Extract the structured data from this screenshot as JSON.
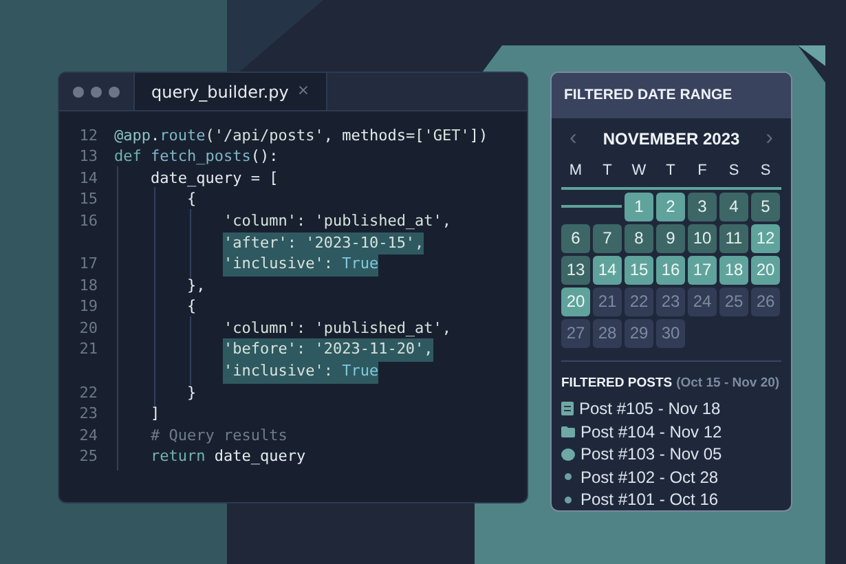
{
  "editor": {
    "tab": {
      "label": "query_builder.py",
      "close": "×",
      "selected": true
    },
    "lines": [
      {
        "number": "12",
        "tokens": [
          {
            "text": "@app",
            "kind": "deco"
          },
          {
            "text": ".",
            "kind": "plain"
          },
          {
            "text": "route",
            "kind": "func"
          },
          {
            "text": "('/api/posts'",
            "kind": "string"
          },
          {
            "text": ", methods=[",
            "kind": "plain"
          },
          {
            "text": "'GET'",
            "kind": "string"
          },
          {
            "text": "])",
            "kind": "plain"
          }
        ]
      },
      {
        "number": "13",
        "tokens": [
          {
            "text": "def ",
            "kind": "keyword"
          },
          {
            "text": "fetch_posts",
            "kind": "func"
          },
          {
            "text": "():",
            "kind": "plain"
          }
        ]
      },
      {
        "number": "14",
        "tokens": [
          {
            "text": "    date_query = [",
            "kind": "plain"
          }
        ]
      },
      {
        "number": "15",
        "tokens": [
          {
            "text": "        {",
            "kind": "plain"
          }
        ]
      },
      {
        "number": "16",
        "tokens": [
          {
            "text": "            'column': 'published_at',",
            "kind": "string"
          }
        ]
      },
      {
        "highlighted": true,
        "tokens": [
          {
            "text": "            'after': '2023-10-15',",
            "kind": "string"
          }
        ]
      },
      {
        "number": "17",
        "highlighted": true,
        "tokens": [
          {
            "text": "            'inclusive': ",
            "kind": "string"
          },
          {
            "text": "True",
            "kind": "const"
          }
        ]
      },
      {
        "number": "18",
        "tokens": [
          {
            "text": "        },",
            "kind": "plain"
          }
        ]
      },
      {
        "number": "19",
        "tokens": [
          {
            "text": "        {",
            "kind": "plain"
          }
        ]
      },
      {
        "number": "20",
        "tokens": [
          {
            "text": "            'column': 'published_at',",
            "kind": "string"
          }
        ]
      },
      {
        "number": "21",
        "highlighted": true,
        "tokens": [
          {
            "text": "            'before': '2023-11-20',",
            "kind": "string"
          }
        ]
      },
      {
        "highlighted": true,
        "tokens": [
          {
            "text": "            'inclusive': ",
            "kind": "string"
          },
          {
            "text": "True",
            "kind": "const"
          }
        ]
      },
      {
        "number": "22",
        "tokens": [
          {
            "text": "        }",
            "kind": "plain"
          }
        ]
      },
      {
        "number": "23",
        "tokens": [
          {
            "text": "    ]",
            "kind": "plain"
          }
        ]
      },
      {
        "number": "24",
        "tokens": [
          {
            "text": "    # Query results",
            "kind": "comment"
          }
        ]
      },
      {
        "number": "25",
        "tokens": [
          {
            "text": "    return ",
            "kind": "keyword"
          },
          {
            "text": "date_query",
            "kind": "plain"
          }
        ]
      }
    ]
  },
  "panel": {
    "title": "FILTERED DATE RANGE",
    "calendar": {
      "prev": "‹",
      "month": "NOVEMBER 2023",
      "next": "›",
      "weekdays": [
        "M",
        "T",
        "W",
        "T",
        "F",
        "S",
        "S"
      ],
      "days": [
        {
          "day": "1",
          "kind": "selected"
        },
        {
          "day": "2",
          "kind": "selected"
        },
        {
          "day": "3",
          "kind": "range"
        },
        {
          "day": "4",
          "kind": "range"
        },
        {
          "day": "5",
          "kind": "range"
        },
        {
          "day": "6",
          "kind": "range"
        },
        {
          "day": "7",
          "kind": "range"
        },
        {
          "day": "8",
          "kind": "range"
        },
        {
          "day": "9",
          "kind": "range"
        },
        {
          "day": "10",
          "kind": "range"
        },
        {
          "day": "11",
          "kind": "range"
        },
        {
          "day": "12",
          "kind": "selected"
        },
        {
          "day": "13",
          "kind": "range"
        },
        {
          "day": "14",
          "kind": "selected"
        },
        {
          "day": "15",
          "kind": "selected"
        },
        {
          "day": "16",
          "kind": "selected"
        },
        {
          "day": "17",
          "kind": "selected"
        },
        {
          "day": "18",
          "kind": "selected"
        },
        {
          "day": "20",
          "kind": "selected"
        },
        {
          "day": "20",
          "kind": "selected"
        },
        {
          "day": "21",
          "kind": "outside"
        },
        {
          "day": "22",
          "kind": "outside"
        },
        {
          "day": "23",
          "kind": "outside"
        },
        {
          "day": "24",
          "kind": "outside"
        },
        {
          "day": "25",
          "kind": "outside"
        },
        {
          "day": "26",
          "kind": "outside"
        },
        {
          "day": "27",
          "kind": "outside"
        },
        {
          "day": "28",
          "kind": "outside"
        },
        {
          "day": "29",
          "kind": "outside"
        },
        {
          "day": "30",
          "kind": "outside"
        }
      ]
    },
    "posts": {
      "title": "FILTERED POSTS",
      "range": "(Oct 15 - Nov 20)",
      "items": [
        {
          "label": "Post #105 - Nov 18",
          "kind": "document"
        },
        {
          "label": "Post #104 - Nov 12",
          "kind": "folder"
        },
        {
          "label": "Post #103 - Nov 05",
          "kind": "bubble"
        },
        {
          "label": "Post #102 - Oct 28",
          "kind": "bullet"
        },
        {
          "label": "Post #101 - Oct 16",
          "kind": "bullet"
        }
      ]
    }
  }
}
